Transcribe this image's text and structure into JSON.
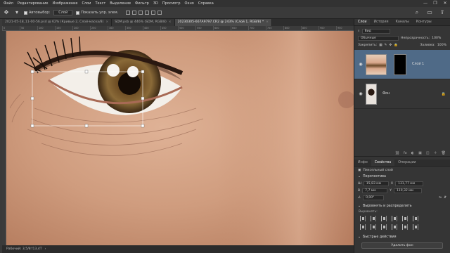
{
  "menu": [
    "Файл",
    "Редактирование",
    "Изображение",
    "Слои",
    "Текст",
    "Выделение",
    "Фильтр",
    "3D",
    "Просмотр",
    "Окно",
    "Справка"
  ],
  "window_controls": [
    "—",
    "❐",
    "✕"
  ],
  "options": {
    "autoselect_label": "Автовыбор:",
    "autoselect_value": "Слой",
    "show_transform_label": "Показать упр. элем."
  },
  "tabs": [
    {
      "label": "2021-05-18_11-00-56.psd @ 62% (Кривые 2, Слой-маска/8)",
      "close": "×"
    },
    {
      "label": "SDM.psb @ 446% (SDM, RGB/8)",
      "close": "×"
    },
    {
      "label": "20230305-667A9797.CR2 @ 243% (Слой 1, RGB/8) *",
      "close": "×"
    }
  ],
  "ruler_ticks": [
    "0",
    "50",
    "100",
    "150",
    "200",
    "250",
    "300",
    "350",
    "400",
    "450",
    "500",
    "550",
    "600",
    "650",
    "700",
    "750",
    "800",
    "850",
    "900",
    "950"
  ],
  "status": {
    "text": "Рабочий: 3,5/8'/13,4T",
    "arrow": "›"
  },
  "panel_tabs": [
    "Слои",
    "История",
    "Каналы",
    "Контуры"
  ],
  "layers_panel": {
    "filter_label": "Вид",
    "blend_mode": "Обычные",
    "opacity_label": "Непрозрачность:",
    "opacity_value": "100%",
    "lock_label": "Закрепить:",
    "fill_label": "Заливка:",
    "fill_value": "100%",
    "layers": [
      {
        "name": "Слой 1",
        "active": true
      },
      {
        "name": "Фон",
        "active": false
      }
    ],
    "bottom_icons": [
      "fx",
      "◐",
      "▣",
      "◫",
      "＋",
      "🗑"
    ]
  },
  "props_tabs": [
    "Инфо",
    "Свойства",
    "Операции"
  ],
  "properties": {
    "layer_type": "Пиксельный слой",
    "transform_title": "Перспектива",
    "w_label": "Ш",
    "w_value": "15,83 мм",
    "h_label": "В",
    "h_value": "7,7 мм",
    "x_label": "X",
    "x_value": "131,77 мм",
    "y_label": "Y",
    "y_value": "110,32 мм",
    "angle_value": "0,00°",
    "align_title": "Выровнять и распределить",
    "align_sub": "Выровнять:",
    "quick_title": "Быстрые действия",
    "quick_button": "Удалить фон"
  },
  "colors": {
    "accent": "#4f6a87",
    "bg": "#2b2b2b",
    "panel": "#353535",
    "skin": "#c89578"
  }
}
